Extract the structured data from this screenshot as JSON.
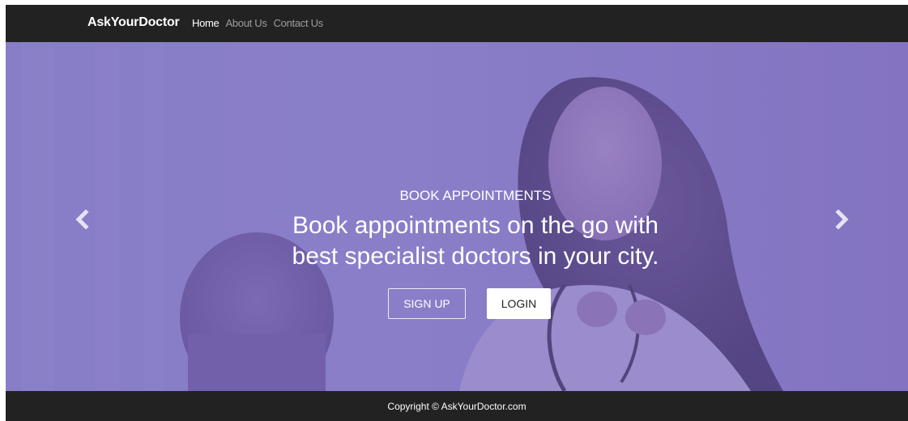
{
  "navbar": {
    "brand": "AskYourDoctor",
    "links": [
      {
        "label": "Home",
        "active": true
      },
      {
        "label": "About Us",
        "active": false
      },
      {
        "label": "Contact Us",
        "active": false
      }
    ]
  },
  "hero": {
    "kicker": "BOOK APPOINTMENTS",
    "title_line1": "Book appointments on the go with",
    "title_line2": "best specialist doctors in your city.",
    "signup_label": "SIGN UP",
    "login_label": "LOGIN",
    "prev_icon": "chevron-left-icon",
    "next_icon": "chevron-right-icon"
  },
  "footer": {
    "copyright": "Copyright © AskYourDoctor.com"
  },
  "colors": {
    "navbar_bg": "#222222",
    "hero_tint": "#8a7fc4",
    "text_white": "#ffffff",
    "nav_muted": "#9d9d9d"
  }
}
